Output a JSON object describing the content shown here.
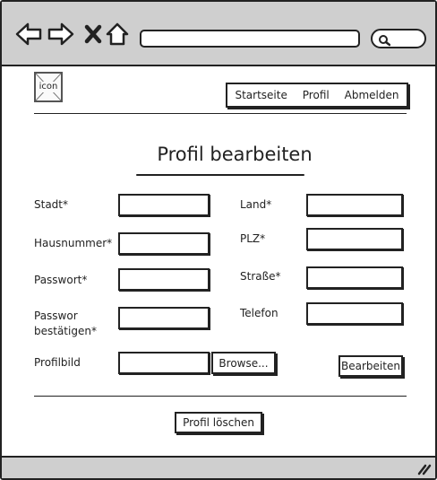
{
  "browser": {
    "icons": [
      "back-arrow-icon",
      "forward-arrow-icon",
      "close-icon",
      "home-icon",
      "search-icon",
      "resize-grip-icon"
    ],
    "url": "",
    "search": ""
  },
  "header": {
    "logo_text": "icon",
    "menu": {
      "home": "Startseite",
      "profile": "Profil",
      "logout": "Abmelden"
    }
  },
  "form": {
    "title": "Profil bearbeiten",
    "labels": {
      "stadt": "Stadt*",
      "hausnummer": "Hausnummer*",
      "passwort": "Passwort*",
      "passwort_confirm_line1": "Passwor",
      "passwort_confirm_line2": "bestätigen*",
      "profilbild": "Profilbild",
      "land": "Land*",
      "plz": "PLZ*",
      "strasse": "Straße*",
      "telefon": "Telefon"
    },
    "values": {
      "stadt": "",
      "hausnummer": "",
      "passwort": "",
      "passwort_confirm": "",
      "profilbild": "",
      "land": "",
      "plz": "",
      "strasse": "",
      "telefon": ""
    },
    "browse_label": "Browse...",
    "submit_label": "Bearbeiten",
    "delete_label": "Profil löschen"
  }
}
